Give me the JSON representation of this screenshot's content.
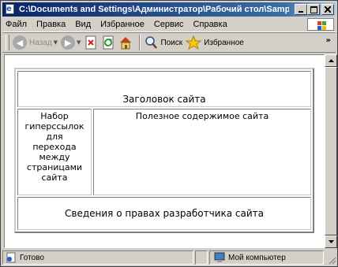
{
  "window": {
    "title": "C:\\Documents and Settings\\Администратор\\Рабочий стол\\Samples\\fr..."
  },
  "menu": [
    "Файл",
    "Правка",
    "Вид",
    "Избранное",
    "Сервис",
    "Справка"
  ],
  "toolbar": {
    "back_label": "Назад",
    "search_label": "Поиск",
    "favorites_label": "Избранное",
    "chevron": "»"
  },
  "page": {
    "header": "Заголовок сайта",
    "nav": [
      "Набор",
      "гиперссылок",
      "для",
      "перехода",
      "между",
      "страницами",
      "сайта"
    ],
    "main": "Полезное содержимое сайта",
    "footer": "Сведения о правах разработчика сайта"
  },
  "status": {
    "text": "Готово",
    "zone": "Мой компьютер"
  },
  "colors": {
    "titlebar_start": "#0a246a",
    "titlebar_end": "#a6caf0",
    "chrome": "#d4d0c8"
  }
}
